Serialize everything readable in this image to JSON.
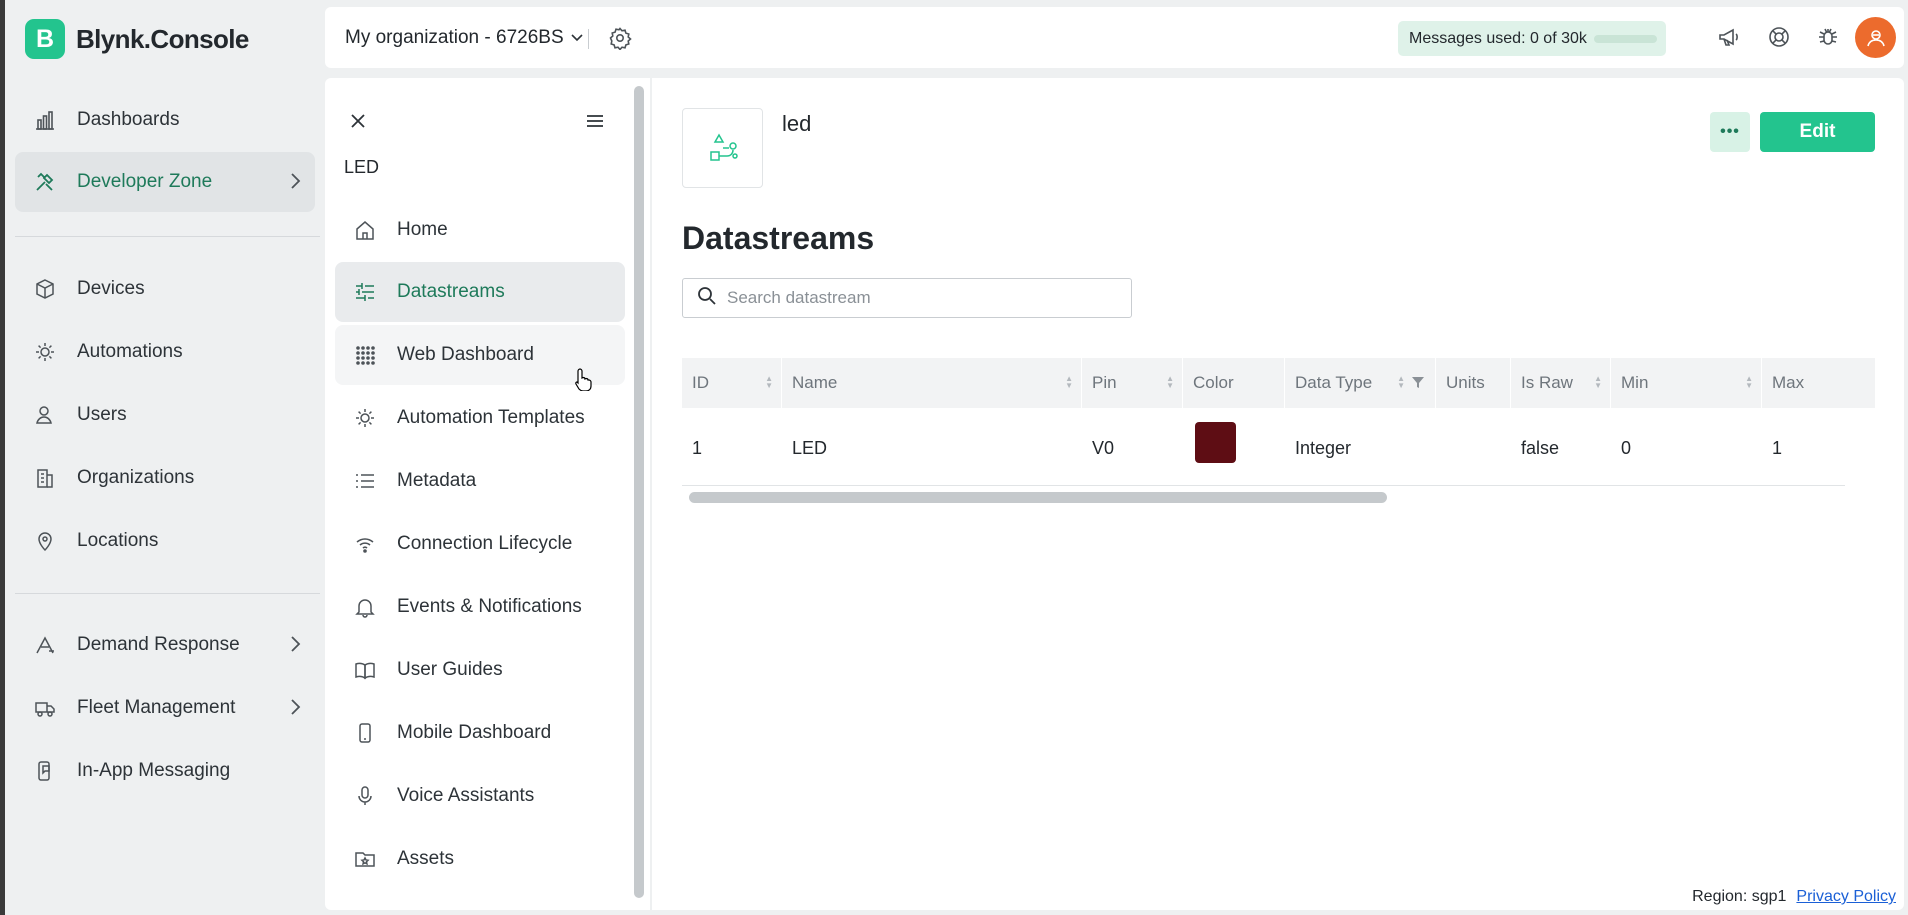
{
  "app": {
    "logo_letter": "B",
    "name": "Blynk.Console"
  },
  "sidebar": {
    "items": [
      {
        "label": "Dashboards"
      },
      {
        "label": "Developer Zone"
      },
      {
        "label": "Devices"
      },
      {
        "label": "Automations"
      },
      {
        "label": "Users"
      },
      {
        "label": "Organizations"
      },
      {
        "label": "Locations"
      },
      {
        "label": "Demand Response"
      },
      {
        "label": "Fleet Management"
      },
      {
        "label": "In-App Messaging"
      }
    ]
  },
  "topbar": {
    "org": "My organization - 6726BS",
    "messages_label": "Messages used: 0 of 30k",
    "messages_used_fraction": 0
  },
  "panel": {
    "title": "LED",
    "items": [
      {
        "label": "Home"
      },
      {
        "label": "Datastreams"
      },
      {
        "label": "Web Dashboard"
      },
      {
        "label": "Automation Templates"
      },
      {
        "label": "Metadata"
      },
      {
        "label": "Connection Lifecycle"
      },
      {
        "label": "Events & Notifications"
      },
      {
        "label": "User Guides"
      },
      {
        "label": "Mobile Dashboard"
      },
      {
        "label": "Voice Assistants"
      },
      {
        "label": "Assets"
      }
    ]
  },
  "main": {
    "product_name": "led",
    "more_label": "•••",
    "edit_label": "Edit",
    "section_title": "Datastreams",
    "search_placeholder": "Search datastream",
    "columns": [
      "ID",
      "Name",
      "Pin",
      "Color",
      "Data Type",
      "Units",
      "Is Raw",
      "Min",
      "Max"
    ],
    "rows": [
      {
        "id": "1",
        "name": "LED",
        "pin": "V0",
        "color": "#5e0d14",
        "data_type": "Integer",
        "units": "",
        "is_raw": "false",
        "min": "0",
        "max": "1"
      }
    ]
  },
  "footer": {
    "region": "Region: sgp1",
    "privacy": "Privacy Policy"
  },
  "colors": {
    "accent": "#23c48e",
    "active_text": "#1e7a5a",
    "avatar": "#ec6b2d"
  }
}
